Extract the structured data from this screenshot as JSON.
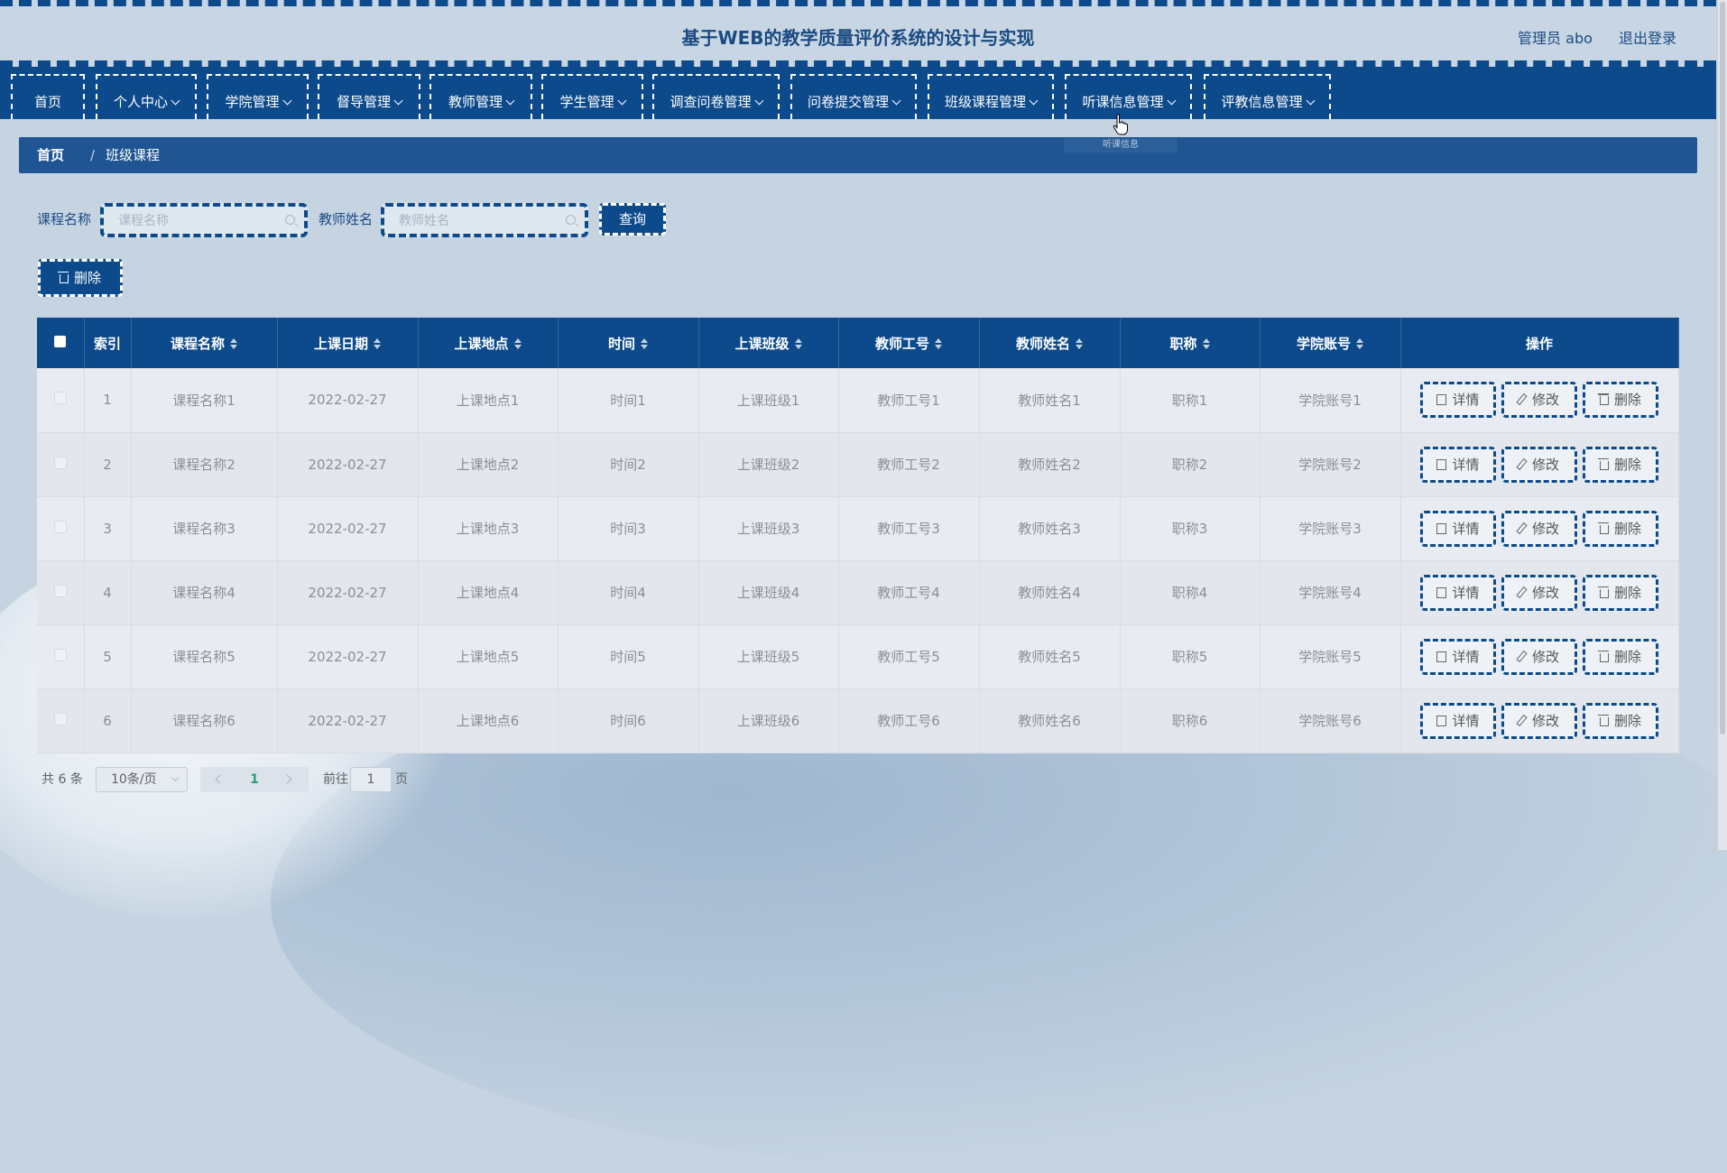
{
  "header": {
    "title": "基于WEB的教学质量评价系统的设计与实现",
    "user_label": "管理员 abo",
    "logout_label": "退出登录"
  },
  "nav": [
    {
      "label": "首页",
      "has_dropdown": false
    },
    {
      "label": "个人中心",
      "has_dropdown": true
    },
    {
      "label": "学院管理",
      "has_dropdown": true
    },
    {
      "label": "督导管理",
      "has_dropdown": true
    },
    {
      "label": "教师管理",
      "has_dropdown": true
    },
    {
      "label": "学生管理",
      "has_dropdown": true
    },
    {
      "label": "调查问卷管理",
      "has_dropdown": true
    },
    {
      "label": "问卷提交管理",
      "has_dropdown": true
    },
    {
      "label": "班级课程管理",
      "has_dropdown": true
    },
    {
      "label": "听课信息管理",
      "has_dropdown": true
    },
    {
      "label": "评教信息管理",
      "has_dropdown": true
    }
  ],
  "nav_dropdown_item": "听课信息",
  "breadcrumb": {
    "home": "首页",
    "separator": "/",
    "current": "班级课程"
  },
  "search": {
    "course_label": "课程名称",
    "course_placeholder": "课程名称",
    "teacher_label": "教师姓名",
    "teacher_placeholder": "教师姓名",
    "query_button": "查询"
  },
  "batch_delete_button": "删除",
  "table": {
    "columns": [
      "索引",
      "课程名称",
      "上课日期",
      "上课地点",
      "时间",
      "上课班级",
      "教师工号",
      "教师姓名",
      "职称",
      "学院账号",
      "操作"
    ],
    "rows": [
      [
        "1",
        "课程名称1",
        "2022-02-27",
        "上课地点1",
        "时间1",
        "上课班级1",
        "教师工号1",
        "教师姓名1",
        "职称1",
        "学院账号1"
      ],
      [
        "2",
        "课程名称2",
        "2022-02-27",
        "上课地点2",
        "时间2",
        "上课班级2",
        "教师工号2",
        "教师姓名2",
        "职称2",
        "学院账号2"
      ],
      [
        "3",
        "课程名称3",
        "2022-02-27",
        "上课地点3",
        "时间3",
        "上课班级3",
        "教师工号3",
        "教师姓名3",
        "职称3",
        "学院账号3"
      ],
      [
        "4",
        "课程名称4",
        "2022-02-27",
        "上课地点4",
        "时间4",
        "上课班级4",
        "教师工号4",
        "教师姓名4",
        "职称4",
        "学院账号4"
      ],
      [
        "5",
        "课程名称5",
        "2022-02-27",
        "上课地点5",
        "时间5",
        "上课班级5",
        "教师工号5",
        "教师姓名5",
        "职称5",
        "学院账号5"
      ],
      [
        "6",
        "课程名称6",
        "2022-02-27",
        "上课地点6",
        "时间6",
        "上课班级6",
        "教师工号6",
        "教师姓名6",
        "职称6",
        "学院账号6"
      ]
    ],
    "actions": {
      "detail": "详情",
      "edit": "修改",
      "delete": "删除"
    }
  },
  "pagination": {
    "total": "共 6 条",
    "page_size": "10条/页",
    "current_page": "1",
    "goto_label": "前往",
    "goto_value": "1",
    "page_unit": "页"
  },
  "colors": {
    "primary": "#0d4a8c",
    "breadcrumb": "#1e5592",
    "background": "#c6d4e2",
    "current_page": "#1fa37a"
  }
}
